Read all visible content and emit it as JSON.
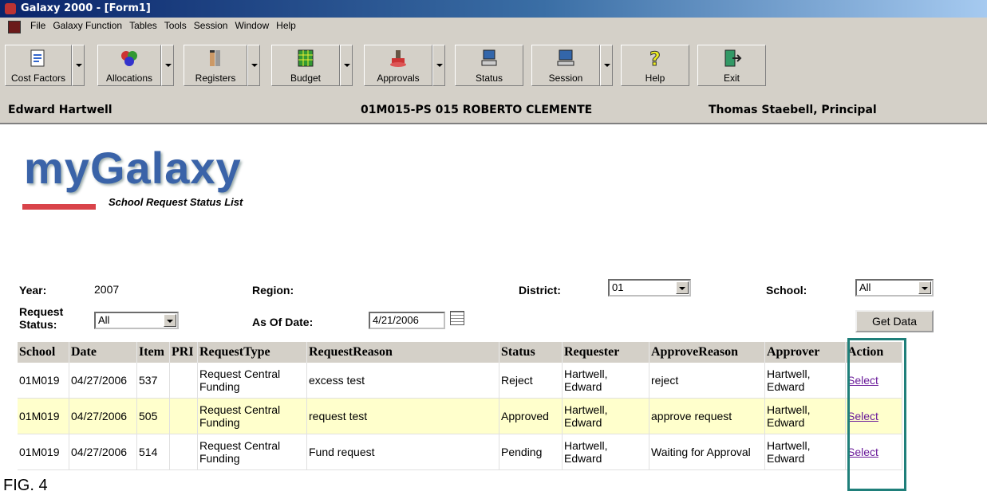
{
  "window": {
    "title": "Galaxy 2000 - [Form1]"
  },
  "menu": [
    "File",
    "Galaxy Function",
    "Tables",
    "Tools",
    "Session",
    "Window",
    "Help"
  ],
  "toolbar": [
    {
      "label": "Cost Factors",
      "icon": "cost-factors-icon",
      "dropdown": true
    },
    {
      "label": "Allocations",
      "icon": "allocations-icon",
      "dropdown": true
    },
    {
      "label": "Registers",
      "icon": "registers-icon",
      "dropdown": true
    },
    {
      "label": "Budget",
      "icon": "budget-icon",
      "dropdown": true
    },
    {
      "label": "Approvals",
      "icon": "approvals-icon",
      "dropdown": true
    },
    {
      "label": "Status",
      "icon": "status-icon",
      "dropdown": false
    },
    {
      "label": "Session",
      "icon": "session-icon",
      "dropdown": true
    },
    {
      "label": "Help",
      "icon": "help-icon",
      "dropdown": false
    },
    {
      "label": "Exit",
      "icon": "exit-icon",
      "dropdown": false
    }
  ],
  "info": {
    "user": "Edward Hartwell",
    "school": "01M015-PS  015 ROBERTO CLEMENTE",
    "principal": "Thomas Staebell,  Principal"
  },
  "page": {
    "logo": "myGalaxy",
    "subtitle": "School Request Status List"
  },
  "filters": {
    "year_label": "Year:",
    "year_value": "2007",
    "region_label": "Region:",
    "district_label": "District:",
    "district_value": "01",
    "school_label": "School:",
    "school_value": "All",
    "request_status_label": "Request Status:",
    "request_status_value": "All",
    "as_of_date_label": "As Of Date:",
    "as_of_date_value": "4/21/2006",
    "get_data_label": "Get Data"
  },
  "table": {
    "headers": [
      "School",
      "Date",
      "Item",
      "PRI",
      "RequestType",
      "RequestReason",
      "Status",
      "Requester",
      "ApproveReason",
      "Approver",
      "Action"
    ],
    "rows": [
      {
        "school": "01M019",
        "date": "04/27/2006",
        "item": "537",
        "pri": "",
        "type": "Request Central Funding",
        "reason": "excess test",
        "status": "Reject",
        "requester": "Hartwell, Edward",
        "approve_reason": "reject",
        "approver": "Hartwell, Edward",
        "action": "Select"
      },
      {
        "school": "01M019",
        "date": "04/27/2006",
        "item": "505",
        "pri": "",
        "type": "Request Central Funding",
        "reason": "request test",
        "status": "Approved",
        "requester": "Hartwell, Edward",
        "approve_reason": "approve request",
        "approver": "Hartwell, Edward",
        "action": "Select"
      },
      {
        "school": "01M019",
        "date": "04/27/2006",
        "item": "514",
        "pri": "",
        "type": "Request Central Funding",
        "reason": "Fund request",
        "status": "Pending",
        "requester": "Hartwell, Edward",
        "approve_reason": "Waiting for Approval",
        "approver": "Hartwell, Edward",
        "action": "Select"
      }
    ]
  },
  "figure_label": "FIG. 4",
  "colors": {
    "accent_box": "#1f7f7a",
    "highlight_row": "#ffffcc",
    "logo": "#3a63a8"
  }
}
